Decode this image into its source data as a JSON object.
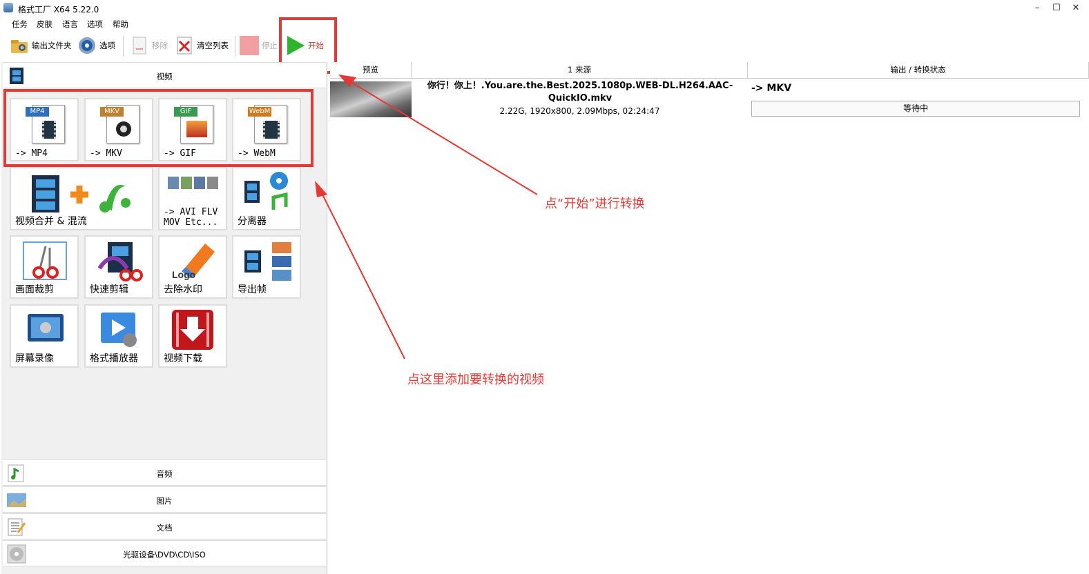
{
  "window": {
    "title": "格式工厂 X64 5.22.0",
    "minimize": "–",
    "maximize": "☐",
    "close": "✕"
  },
  "menu": [
    "任务",
    "皮肤",
    "语言",
    "选项",
    "帮助"
  ],
  "toolbar": {
    "output_folder": "输出文件夹",
    "options": "选项",
    "remove": "移除",
    "clear_list": "清空列表",
    "stop": "停止",
    "start": "开始"
  },
  "left": {
    "video_category": "视频",
    "tiles": [
      {
        "tag": "MP4",
        "label": "-> MP4"
      },
      {
        "tag": "MKV",
        "label": "-> MKV"
      },
      {
        "tag": "GIF",
        "label": "-> GIF"
      },
      {
        "tag": "WebM",
        "label": "-> WebM"
      },
      {
        "label": "视频合并 & 混流"
      },
      {
        "label": "-> AVI FLV\nMOV Etc..."
      },
      {
        "label": "分离器"
      },
      {
        "label": "画面裁剪"
      },
      {
        "label": "快速剪辑"
      },
      {
        "label": "去除水印",
        "logo_text": "Logo"
      },
      {
        "label": "导出帧"
      },
      {
        "label": "屏幕录像"
      },
      {
        "label": "格式播放器"
      },
      {
        "label": "视频下载"
      }
    ],
    "categories": [
      "音频",
      "图片",
      "文档",
      "光驱设备\\DVD\\CD\\ISO"
    ]
  },
  "grid": {
    "headers": [
      "预览",
      "1 来源",
      "输出 / 转换状态"
    ],
    "rows": [
      {
        "filename": "你行！你上！.You.are.the.Best.2025.1080p.WEB-DL.H264.AAC-QuickIO.mkv",
        "info": "2.22G, 1920x800, 2.09Mbps, 02:24:47",
        "output": "-> MKV",
        "status": "等待中"
      }
    ]
  },
  "annotations": {
    "start_hint": "点“开始”进行转换",
    "add_hint": "点这里添加要转换的视频"
  },
  "colors": {
    "annotation": "#e53935",
    "play": "#2db52d"
  }
}
